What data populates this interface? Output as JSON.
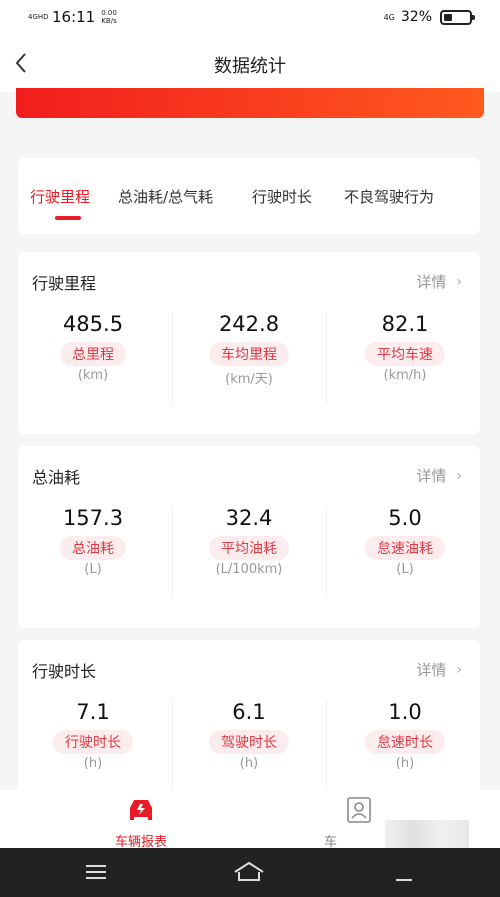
{
  "status_bar": {
    "network": "4GHD",
    "time": "16:11",
    "speed": "0.00",
    "speed_unit": "KB/s",
    "signal_right": "4G",
    "battery": "32%",
    "battery_level": 0.32
  },
  "header": {
    "title": "数据统计"
  },
  "tabs": [
    {
      "label": "行驶里程",
      "active": true
    },
    {
      "label": "总油耗/总气耗",
      "active": false
    },
    {
      "label": "行驶时长",
      "active": false
    },
    {
      "label": "不良驾驶行为",
      "active": false
    }
  ],
  "detail_label": "详情",
  "cards": [
    {
      "title": "行驶里程",
      "metrics": [
        {
          "value": "485.5",
          "label": "总里程",
          "unit": "(km)"
        },
        {
          "value": "242.8",
          "label": "车均里程",
          "unit": "(km/天)"
        },
        {
          "value": "82.1",
          "label": "平均车速",
          "unit": "(km/h)"
        }
      ]
    },
    {
      "title": "总油耗",
      "metrics": [
        {
          "value": "157.3",
          "label": "总油耗",
          "unit": "(L)"
        },
        {
          "value": "32.4",
          "label": "平均油耗",
          "unit": "(L/100km)"
        },
        {
          "value": "5.0",
          "label": "怠速油耗",
          "unit": "(L)"
        }
      ]
    },
    {
      "title": "行驶时长",
      "metrics": [
        {
          "value": "7.1",
          "label": "行驶时长",
          "unit": "(h)"
        },
        {
          "value": "6.1",
          "label": "驾驶时长",
          "unit": "(h)"
        },
        {
          "value": "1.0",
          "label": "怠速时长",
          "unit": "(h)"
        }
      ]
    }
  ],
  "bottom_nav": [
    {
      "label": "车辆报表",
      "icon": "car-report-icon",
      "active": true
    },
    {
      "label": "车",
      "icon": "person-card-icon",
      "active": false
    }
  ],
  "colors": {
    "accent": "#e81c27",
    "label_bg": "#fdecee",
    "label_text": "#e03a45",
    "banner_start": "#f21d1d",
    "banner_end": "#ff5a1e"
  }
}
